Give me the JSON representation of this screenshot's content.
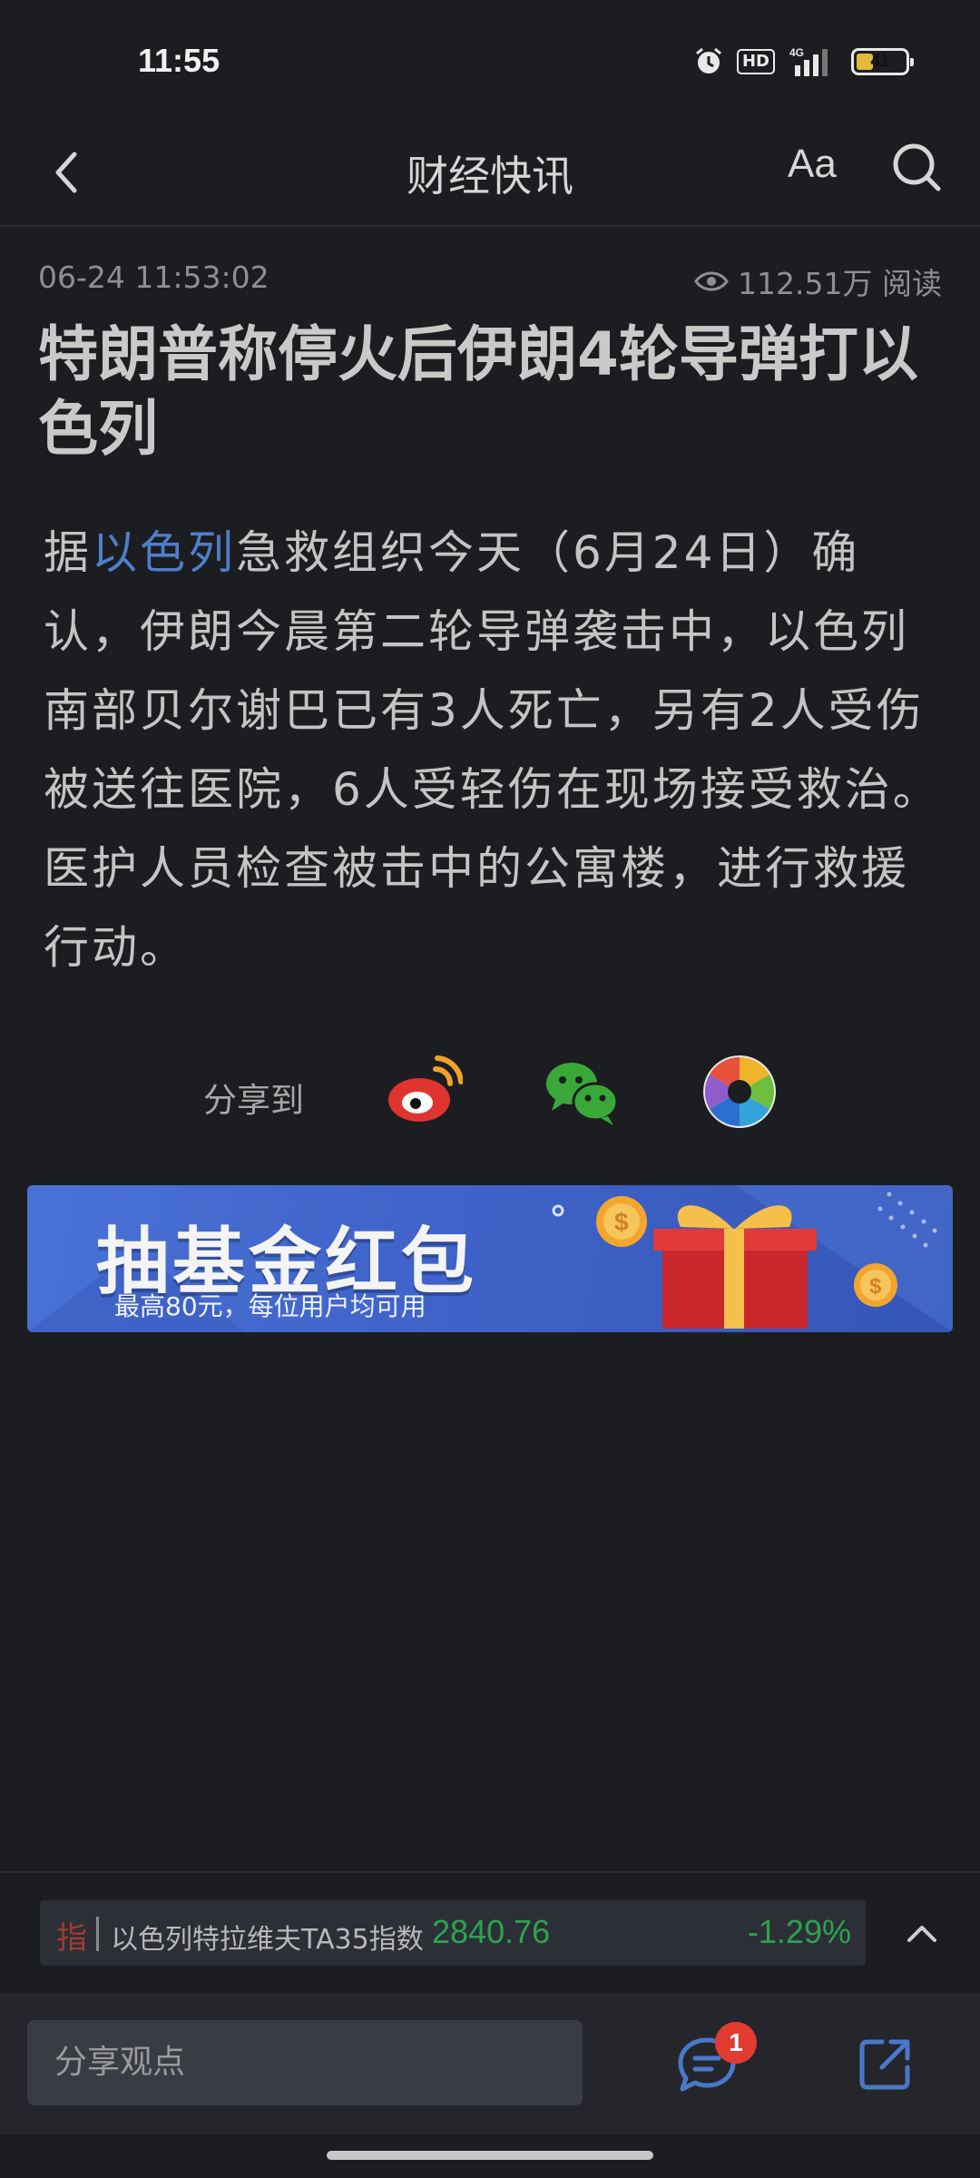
{
  "status_bar": {
    "time": "11:55",
    "network": "4G",
    "hd": "HD",
    "battery": "41",
    "battery_level": 0.41
  },
  "nav": {
    "title": "财经快讯",
    "font_size_label": "Aa"
  },
  "article": {
    "date": "06-24 11:53:02",
    "read_count": "112.51万 阅读",
    "headline": "特朗普称停火后伊朗4轮导弹打以色列",
    "body_prefix": "据",
    "body_link": "以色列",
    "body_rest": "急救组织今天（6月24日）确认，伊朗今晨第二轮导弹袭击中，以色列南部贝尔谢巴已有3人死亡，另有2人受伤被送往医院，6人受轻伤在现场接受救治。医护人员检查被击中的公寓楼，进行救援行动。"
  },
  "share": {
    "label": "分享到",
    "targets": [
      "weibo-icon",
      "wechat-icon",
      "moments-icon"
    ]
  },
  "banner": {
    "title": "抽基金红包",
    "subtitle": "最高80元，每位用户均可用"
  },
  "ticker": {
    "tag": "指",
    "name": "以色列特拉维夫TA35指数",
    "price": "2840.76",
    "change": "-1.29%",
    "color": "#2aa44f"
  },
  "bottom": {
    "placeholder": "分享观点",
    "comment_badge": "1"
  },
  "colors": {
    "background": "#1c1d21",
    "link": "#4f7fc8",
    "badge": "#e23b32"
  }
}
